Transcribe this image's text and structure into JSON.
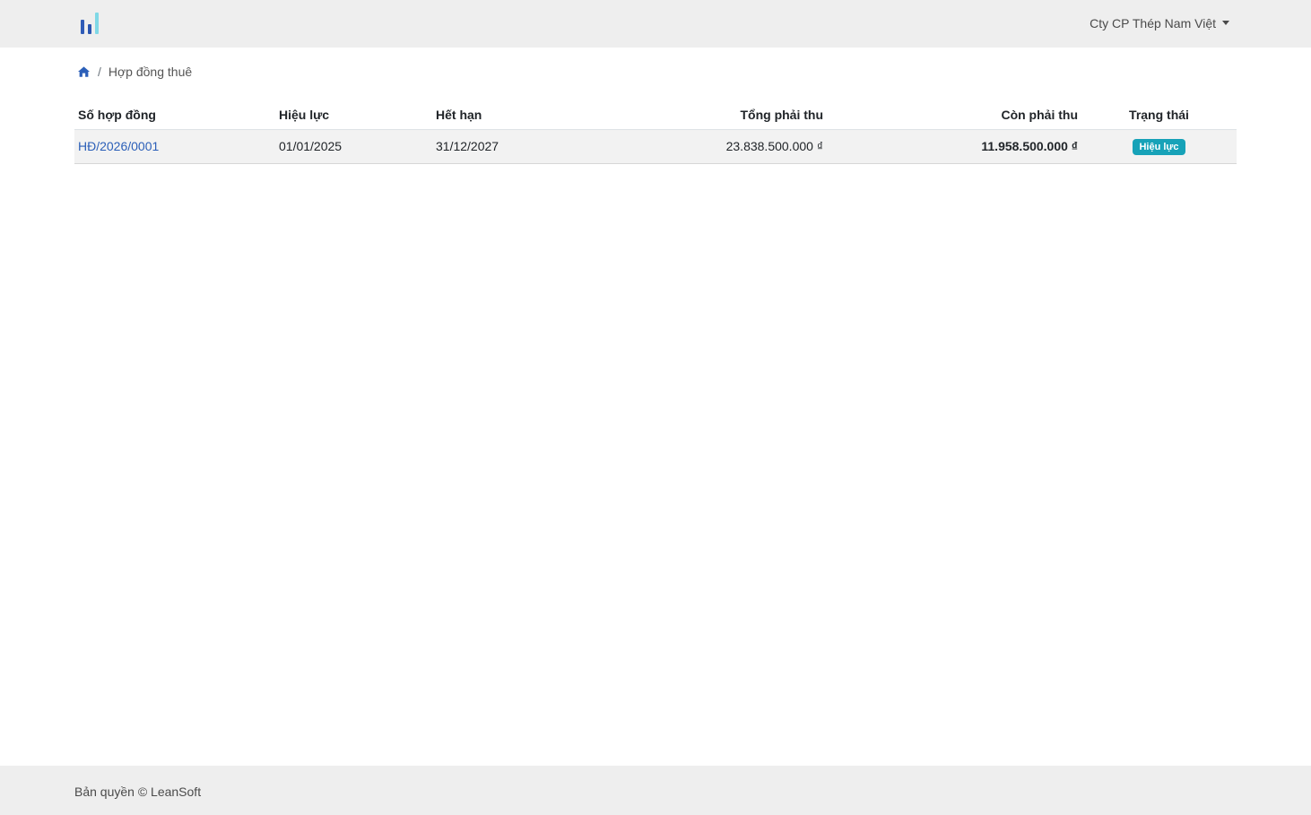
{
  "navbar": {
    "company_name": "Cty CP Thép Nam Việt",
    "logo_icon": "bar-logo-icon",
    "brand_colors": [
      "#2f5bb7",
      "#2a55b0",
      "#7fd8e6"
    ]
  },
  "breadcrumb": {
    "home_icon": "home-icon",
    "separator": "/",
    "current": "Hợp đồng thuê"
  },
  "table": {
    "headers": {
      "contract_no": "Số hợp đồng",
      "effective": "Hiệu lực",
      "expiry": "Hết hạn",
      "total_due": "Tổng phải thu",
      "remaining": "Còn phải thu",
      "status": "Trạng thái"
    },
    "rows": [
      {
        "contract_no": "HĐ/2026/0001",
        "effective": "01/01/2025",
        "expiry": "31/12/2027",
        "total_due": "23.838.500.000 ₫",
        "remaining": "11.958.500.000 ₫",
        "status": "Hiệu lực"
      }
    ]
  },
  "footer": {
    "copyright": "Bản quyền © LeanSoft"
  },
  "colors": {
    "link": "#2b5fb8",
    "due": "#dc3545",
    "badge": "#17a2b8",
    "bar_bg": "#eeeeee"
  }
}
